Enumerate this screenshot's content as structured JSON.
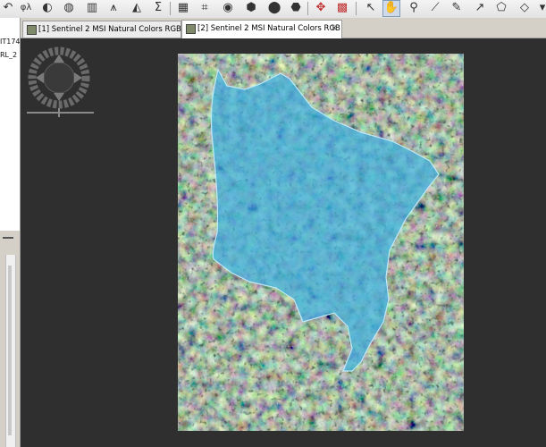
{
  "toolbar": {
    "icons": [
      "undo-icon",
      "formula-icon",
      "sigma-icon",
      "mask-icon",
      "histogram-icon",
      "scatter-icon",
      "statistics-icon",
      "sum-icon",
      "layers-icon",
      "grid-icon",
      "info-icon",
      "eye-icon",
      "pin-icon",
      "pin-manager-icon",
      "range-finder-icon",
      "gcp-icon",
      "select-icon",
      "pan-icon",
      "zoom-icon",
      "draw-line-icon",
      "draw-rect-icon",
      "draw-polygon-icon",
      "draw-ellipse-icon",
      "dropdown-icon"
    ],
    "icon_glyphs": {
      "formula": "φλ",
      "sum": "Σ"
    }
  },
  "left_panel": {
    "line1": "IT174",
    "line2": "RL_2"
  },
  "tabs": [
    {
      "label": "[1] Sentinel 2 MSI Natural Colors RGB",
      "active": false
    },
    {
      "label": "[2] Sentinel 2 MSI Natural Colors RGB",
      "active": true
    }
  ],
  "colors": {
    "view_background": "#2f2f2f",
    "mask_fill": "#3fb0e0",
    "mask_stroke": "#bfe8f7"
  }
}
